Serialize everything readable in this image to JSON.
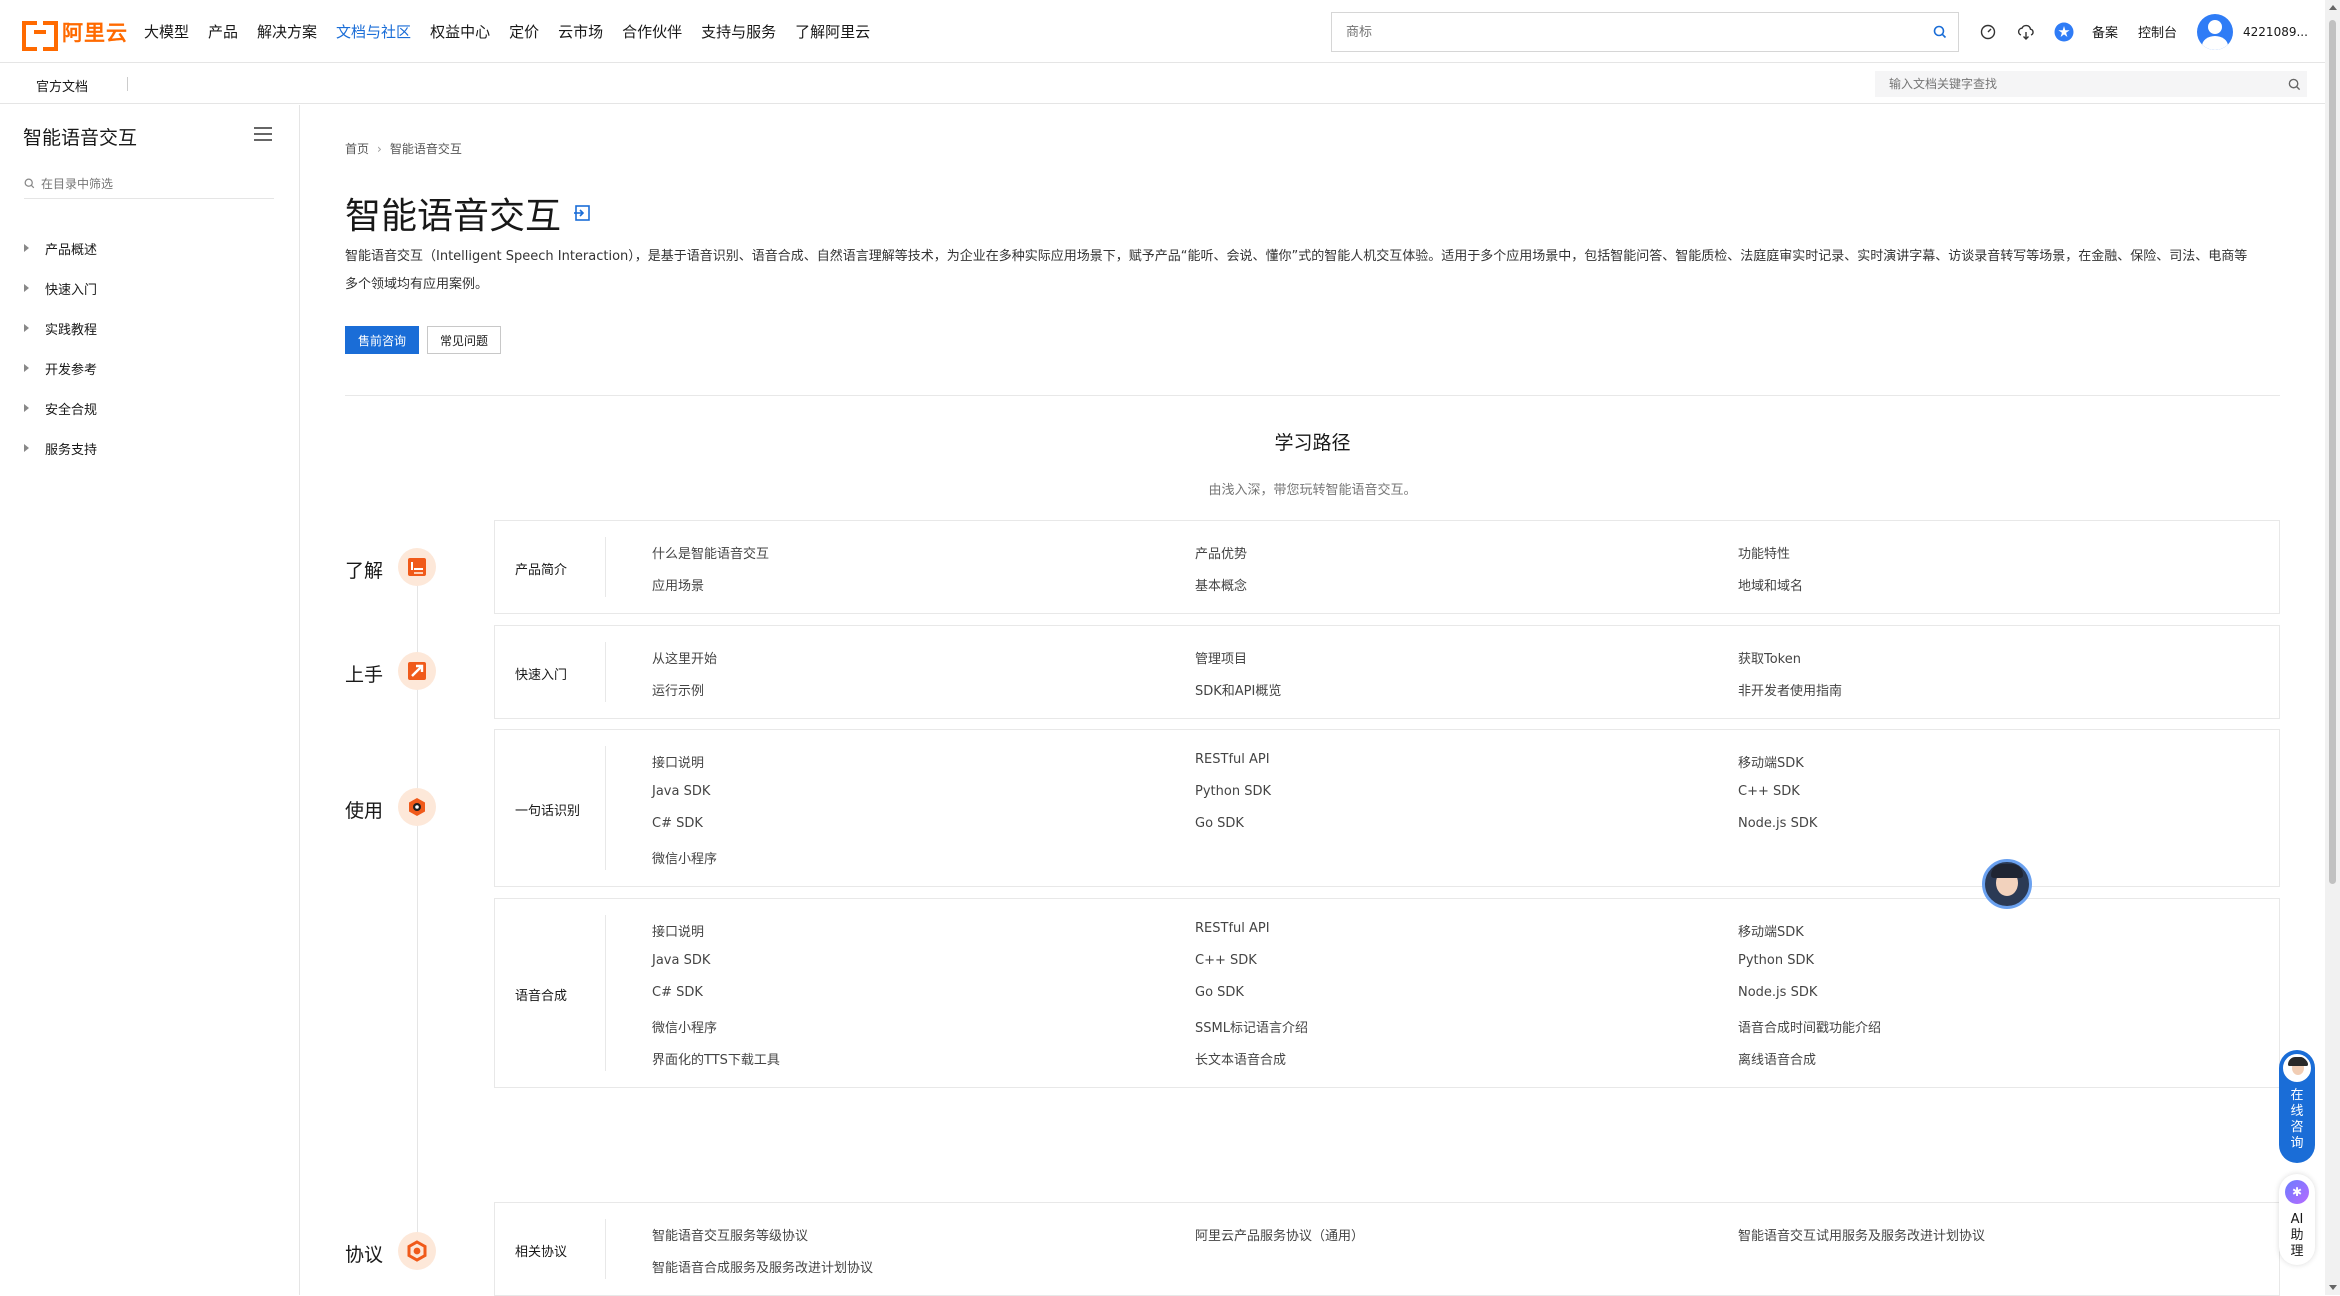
{
  "brand": {
    "logo_text": "阿里云",
    "accent": "#ff6a00",
    "link_color": "#1a6dd7"
  },
  "nav": {
    "items": [
      {
        "label": "大模型"
      },
      {
        "label": "产品"
      },
      {
        "label": "解决方案"
      },
      {
        "label": "文档与社区",
        "active": true
      },
      {
        "label": "权益中心"
      },
      {
        "label": "定价"
      },
      {
        "label": "云市场"
      },
      {
        "label": "合作伙伴"
      },
      {
        "label": "支持与服务"
      },
      {
        "label": "了解阿里云"
      }
    ],
    "search_placeholder": "商标",
    "icons": [
      "dashboard-icon",
      "cloud-download-icon",
      "star-badge-icon"
    ],
    "beian": "备案",
    "console": "控制台",
    "user_id": "4221089..."
  },
  "subnav": {
    "title": "官方文档",
    "search_placeholder": "输入文档关键字查找"
  },
  "sidebar": {
    "title": "智能语音交互",
    "filter_placeholder": "在目录中筛选",
    "items": [
      {
        "label": "产品概述"
      },
      {
        "label": "快速入门"
      },
      {
        "label": "实践教程"
      },
      {
        "label": "开发参考"
      },
      {
        "label": "安全合规"
      },
      {
        "label": "服务支持"
      }
    ]
  },
  "main": {
    "breadcrumb": [
      "首页",
      "智能语音交互"
    ],
    "title": "智能语音交互",
    "description": "智能语音交互（Intelligent Speech Interaction），是基于语音识别、语音合成、自然语言理解等技术，为企业在多种实际应用场景下，赋予产品“能听、会说、懂你”式的智能人机交互体验。适用于多个应用场景中，包括智能问答、智能质检、法庭庭审实时记录、实时演讲字幕、访谈录音转写等场景，在金融、保险、司法、电商等多个领域均有应用案例。",
    "btn_primary": "售前咨询",
    "btn_secondary": "常见问题",
    "learning_path": {
      "title": "学习路径",
      "subtitle": "由浅入深，带您玩转智能语音交互。",
      "stages": [
        {
          "label": "了解"
        },
        {
          "label": "上手"
        },
        {
          "label": "使用"
        },
        {
          "label": "协议"
        }
      ],
      "cards": [
        {
          "label": "产品简介",
          "rows": [
            [
              "什么是智能语音交互",
              "产品优势",
              "功能特性"
            ],
            [
              "应用场景",
              "基本概念",
              "地域和域名"
            ]
          ]
        },
        {
          "label": "快速入门",
          "rows": [
            [
              "从这里开始",
              "管理项目",
              "获取Token"
            ],
            [
              "运行示例",
              "SDK和API概览",
              "非开发者使用指南"
            ]
          ]
        },
        {
          "label": "一句话识别",
          "rows": [
            [
              "接口说明",
              "RESTful API",
              "移动端SDK"
            ],
            [
              "Java SDK",
              "Python SDK",
              "C++ SDK"
            ],
            [
              "C# SDK",
              "Go SDK",
              "Node.js SDK"
            ],
            [
              "微信小程序",
              "",
              ""
            ]
          ]
        },
        {
          "label": "语音合成",
          "rows": [
            [
              "接口说明",
              "RESTful API",
              "移动端SDK"
            ],
            [
              "Java SDK",
              "C++ SDK",
              "Python SDK"
            ],
            [
              "C# SDK",
              "Go SDK",
              "Node.js SDK"
            ],
            [
              "微信小程序",
              "SSML标记语言介绍",
              "语音合成时间戳功能介绍"
            ],
            [
              "界面化的TTS下载工具",
              "长文本语音合成",
              "离线语音合成"
            ]
          ]
        },
        {
          "label": "相关协议",
          "rows": [
            [
              "智能语音交互服务等级协议",
              "阿里云产品服务协议（通用）",
              "智能语音交互试用服务及服务改进计划协议"
            ],
            [
              "智能语音合成服务及服务改进计划协议",
              "",
              ""
            ]
          ]
        }
      ]
    }
  },
  "floating": {
    "consult_label": "在线咨询",
    "ai_label": "AI助理",
    "ai_badge": "✱"
  }
}
